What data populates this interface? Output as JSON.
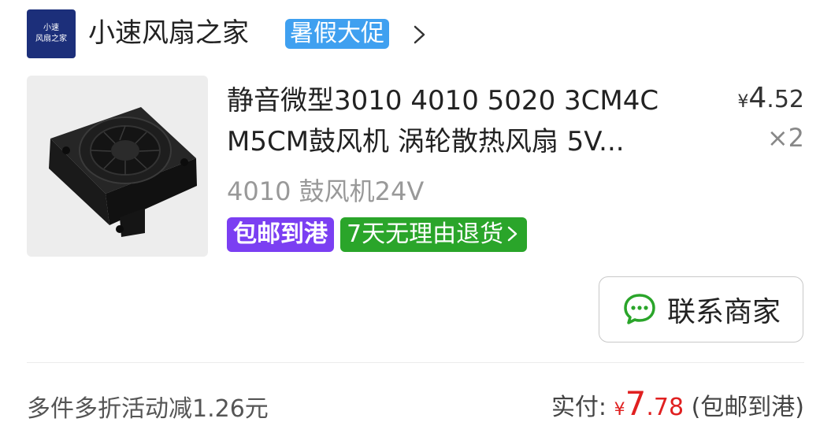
{
  "store": {
    "logo_line1": "小速",
    "logo_line2": "风扇之家",
    "name": "小速风扇之家",
    "promo_badge": "暑假大促"
  },
  "item": {
    "title_line1": "静音微型3010 4010 5020 3CM4C",
    "title_line2": "M5CM鼓风机 涡轮散热风扇 5V...",
    "currency": "¥",
    "price_int": "4",
    "price_dec": ".52",
    "quantity": "×2",
    "variant": "4010 鼓风机24V",
    "tags": [
      "包邮到港",
      "7天无理由退货"
    ]
  },
  "contact_button": {
    "label": "联系商家"
  },
  "footer": {
    "discount_text": "多件多折活动减1.26元",
    "paid_label": "实付: ",
    "currency": "¥",
    "paid_int": "7",
    "paid_dec": ".78",
    "paid_note": " (包邮到港)"
  },
  "colors": {
    "logo_bg": "#1c2f7a",
    "promo_badge": "#3fa0f0",
    "tag_free_shipping": "#7b3ff2",
    "tag_return": "#2aa52a",
    "price_red": "#e02020",
    "chat_icon": "#2aa52a"
  },
  "icons": [
    "chevron-right-icon",
    "chat-bubble-icon"
  ]
}
